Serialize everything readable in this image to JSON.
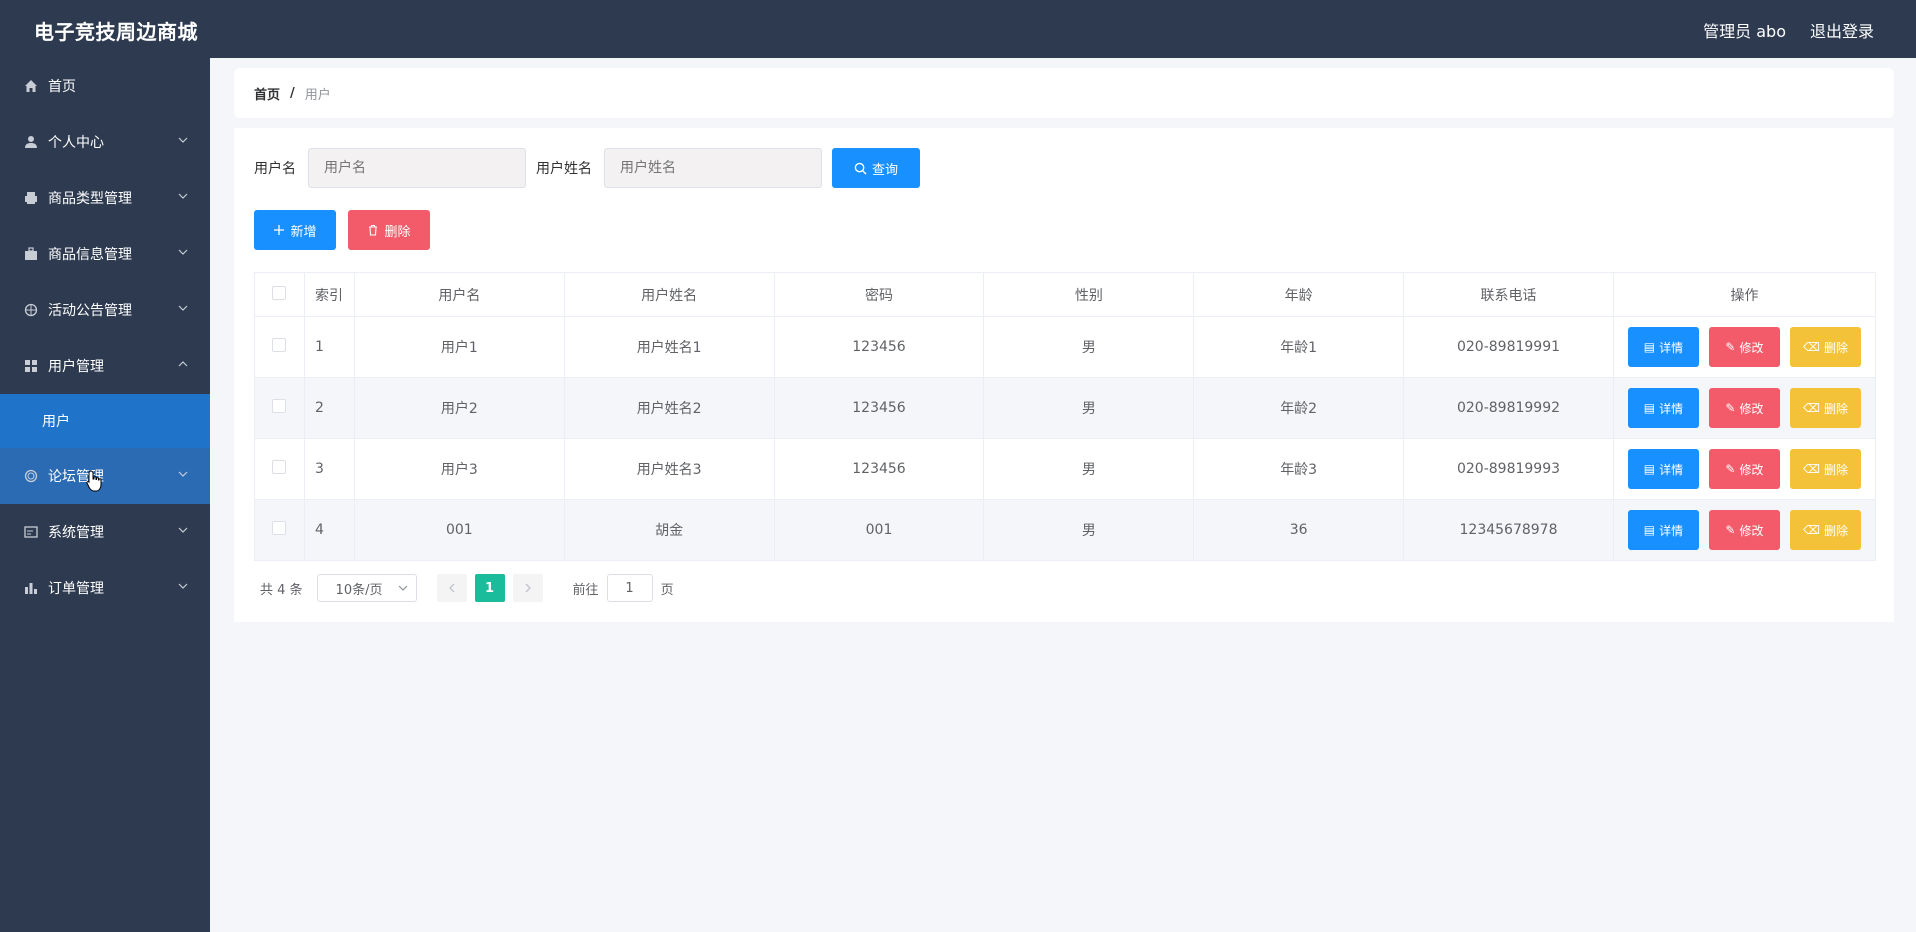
{
  "header": {
    "title": "电子竞技周边商城",
    "admin": "管理员 abo",
    "logout": "退出登录"
  },
  "sidebar": {
    "items": [
      {
        "label": "首页",
        "icon": "home-icon"
      },
      {
        "label": "个人中心",
        "icon": "user-icon"
      },
      {
        "label": "商品类型管理",
        "icon": "printer-icon"
      },
      {
        "label": "商品信息管理",
        "icon": "briefcase-icon"
      },
      {
        "label": "活动公告管理",
        "icon": "globe-icon"
      },
      {
        "label": "用户管理",
        "icon": "grid-icon"
      },
      {
        "label": "论坛管理",
        "icon": "disc-icon"
      },
      {
        "label": "系统管理",
        "icon": "window-icon"
      },
      {
        "label": "订单管理",
        "icon": "bar-chart-icon"
      }
    ],
    "sub_user": "用户"
  },
  "breadcrumb": {
    "home": "首页",
    "sep": "/",
    "current": "用户"
  },
  "search": {
    "username_label": "用户名",
    "username_placeholder": "用户名",
    "realname_label": "用户姓名",
    "realname_placeholder": "用户姓名",
    "query": "查询"
  },
  "actions": {
    "add": "新增",
    "delete": "删除"
  },
  "table": {
    "headers": [
      "索引",
      "用户名",
      "用户姓名",
      "密码",
      "性别",
      "年龄",
      "联系电话",
      "操作"
    ],
    "rows": [
      {
        "idx": "1",
        "username": "用户1",
        "realname": "用户姓名1",
        "password": "123456",
        "gender": "男",
        "age": "年龄1",
        "phone": "020-89819991"
      },
      {
        "idx": "2",
        "username": "用户2",
        "realname": "用户姓名2",
        "password": "123456",
        "gender": "男",
        "age": "年龄2",
        "phone": "020-89819992"
      },
      {
        "idx": "3",
        "username": "用户3",
        "realname": "用户姓名3",
        "password": "123456",
        "gender": "男",
        "age": "年龄3",
        "phone": "020-89819993"
      },
      {
        "idx": "4",
        "username": "001",
        "realname": "胡金",
        "password": "001",
        "gender": "男",
        "age": "36",
        "phone": "12345678978"
      }
    ],
    "op_detail": "详情",
    "op_edit": "修改",
    "op_delete": "删除"
  },
  "pager": {
    "total": "共 4 条",
    "page_size": "10条/页",
    "current_page": "1",
    "goto_label": "前往",
    "goto_value": "1",
    "page_unit": "页"
  },
  "colors": {
    "header_bg": "#2d3a4f",
    "primary": "#1890ff",
    "danger": "#f35b6a",
    "warning": "#f3c239",
    "page_active": "#1bbc9b"
  }
}
